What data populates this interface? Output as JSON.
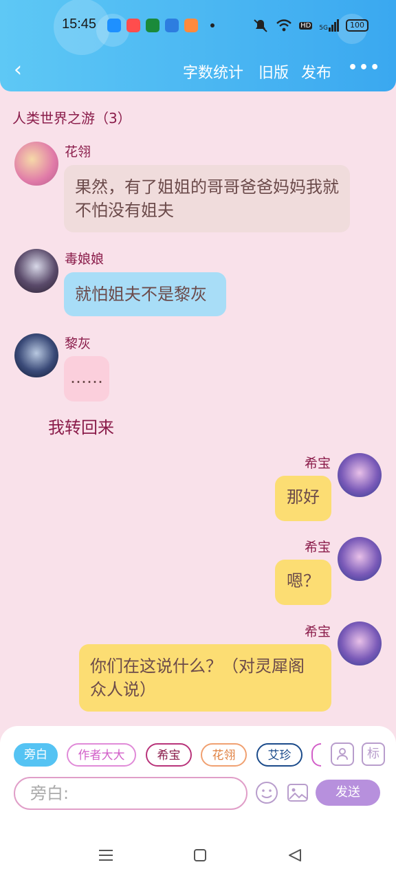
{
  "status_bar": {
    "time": "15:45",
    "battery": "100",
    "network": "5G",
    "hd": "HD"
  },
  "nav": {
    "word_count": "字数统计",
    "old_version": "旧版",
    "publish": "发布",
    "more": "•••",
    "back": "‹"
  },
  "chat": {
    "title": "人类世界之游（3）",
    "messages": [
      {
        "sender": "花翎",
        "text": "果然，有了姐姐的哥哥爸爸妈妈我就不怕没有姐夫"
      },
      {
        "sender": "毒娘娘",
        "text": "就怕姐夫不是黎灰"
      },
      {
        "sender": "黎灰",
        "text": "……"
      },
      {
        "sender": "希宝",
        "text": "那好"
      },
      {
        "sender": "希宝",
        "text": "嗯？"
      },
      {
        "sender": "希宝",
        "text": "你们在这说什么？（对灵犀阁众人说）"
      }
    ],
    "narration": "我转回来"
  },
  "composer": {
    "chips": [
      "旁白",
      "作者大大",
      "希宝",
      "花翎",
      "艾珍"
    ],
    "icon_tag": "标",
    "input_placeholder": "旁白:",
    "send_label": "发送"
  },
  "colors": {
    "header": "#3aa8f0",
    "background": "#f9e1ea",
    "my_bubble": "#fcdd73",
    "send_button": "#b790dd"
  }
}
